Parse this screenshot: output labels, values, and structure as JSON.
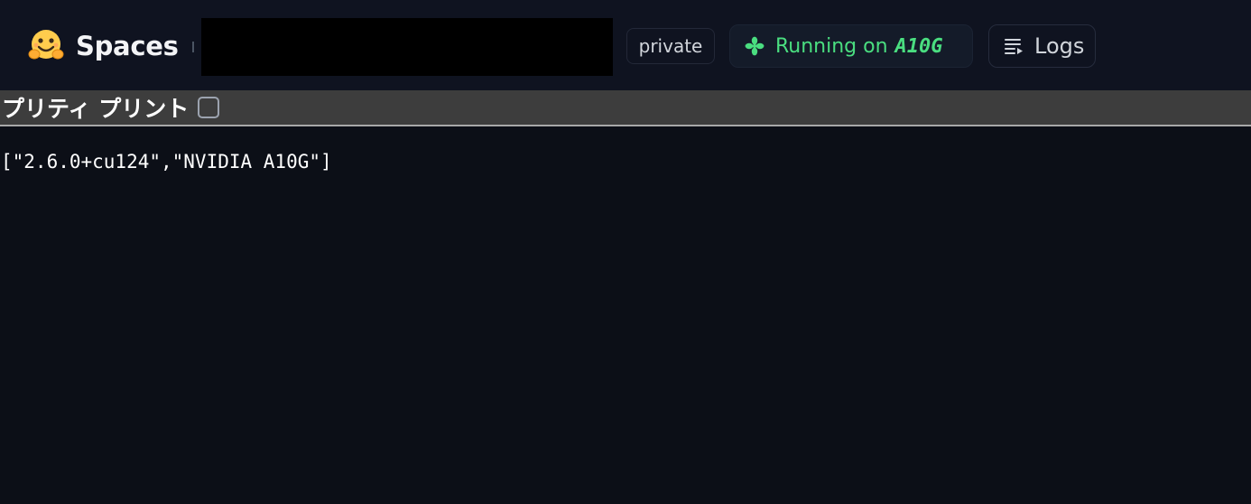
{
  "header": {
    "brand": "Spaces",
    "visibility": "private",
    "status_prefix": "Running on",
    "hardware": "A10G",
    "logs_label": "Logs",
    "brand_icon": "hugging-face-emoji",
    "status_icon": "fan-icon",
    "logs_icon": "logs-icon"
  },
  "controls": {
    "pretty_print_label": "プリティ プリント",
    "pretty_print_checked": false
  },
  "output": {
    "text": "[\"2.6.0+cu124\",\"NVIDIA A10G\"]"
  },
  "colors": {
    "status_green": "#4ade80",
    "background": "#0c0f17",
    "toolbar": "#3d3d3d"
  }
}
